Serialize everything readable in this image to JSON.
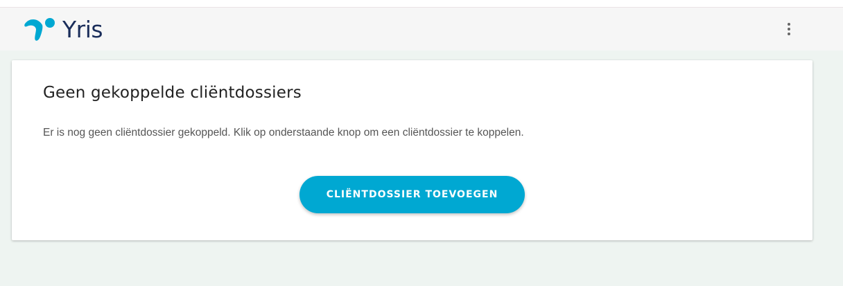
{
  "app": {
    "name": "Yris",
    "brand_color": "#00a8d2",
    "brand_text_color": "#1a2d5a",
    "logo_icon": "yris-logo-icon",
    "menu_icon": "more-vertical-icon"
  },
  "card": {
    "title": "Geen gekoppelde cliëntdossiers",
    "description": "Er is nog geen cliëntdossier gekoppeld. Klik op onderstaande knop om een cliëntdossier te koppelen.",
    "button_label": "CLIËNTDOSSIER TOEVOEGEN"
  }
}
